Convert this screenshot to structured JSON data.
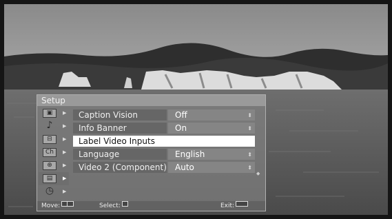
{
  "menu": {
    "title": "Setup",
    "side_icons": [
      {
        "name": "picture-icon",
        "glyph": "▣",
        "selected": false
      },
      {
        "name": "music-note-icon",
        "glyph": "♪",
        "selected": false
      },
      {
        "name": "screen-icon",
        "glyph": "⊟",
        "selected": false
      },
      {
        "name": "channel-icon",
        "glyph": "Ch",
        "selected": false
      },
      {
        "name": "parental-lock-icon",
        "glyph": "⊕",
        "selected": false
      },
      {
        "name": "setup-toolbox-icon",
        "glyph": "▤",
        "selected": true
      },
      {
        "name": "clock-icon",
        "glyph": "◷",
        "selected": false
      }
    ],
    "rows": [
      {
        "label": "Caption Vision",
        "value": "Off"
      },
      {
        "label": "Info Banner",
        "value": "On"
      },
      {
        "label": "Label Video Inputs",
        "value": ""
      },
      {
        "label": "Language",
        "value": "English"
      },
      {
        "label": "Video 2 (Component)",
        "value": "Auto"
      }
    ],
    "highlighted_row": "Label Video Inputs"
  },
  "footer": {
    "move": "Move:",
    "select": "Select:",
    "exit": "Exit:"
  }
}
